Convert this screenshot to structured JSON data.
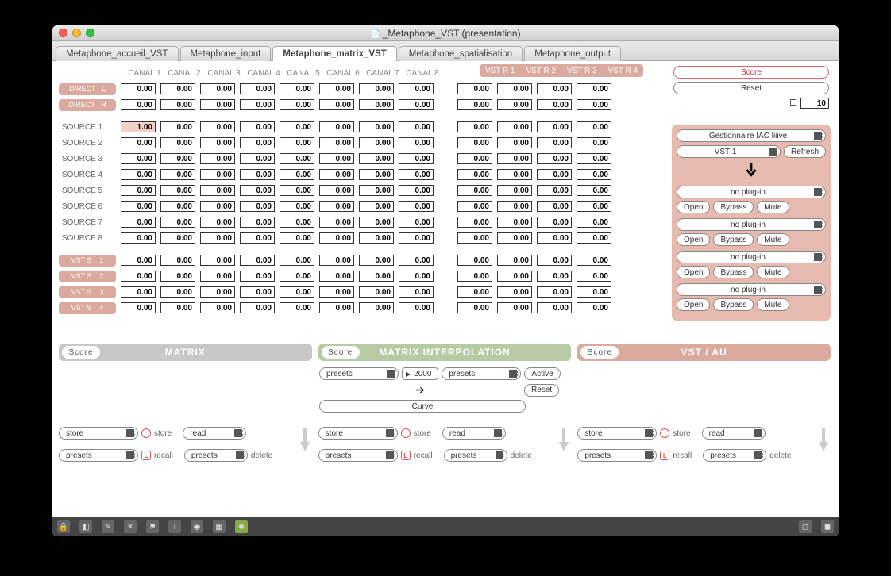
{
  "window": {
    "title": "_Metaphone_VST (presentation)"
  },
  "tabs": [
    {
      "label": "Metaphone_accueil_VST",
      "active": false
    },
    {
      "label": "Metaphone_input",
      "active": false
    },
    {
      "label": "Metaphone_matrix_VST",
      "active": true
    },
    {
      "label": "Metaphone_spatialisation",
      "active": false
    },
    {
      "label": "Metaphone_output",
      "active": false
    }
  ],
  "channels": [
    "CANAL 1",
    "CANAL 2",
    "CANAL 3",
    "CANAL 4",
    "CANAL 5",
    "CANAL 6",
    "CANAL 7",
    "CANAL 8"
  ],
  "vstr": [
    "VST R 1",
    "VST R 2",
    "VST R 3",
    "VST R 4"
  ],
  "direct": {
    "L": "DIRECT   L",
    "R": "DIRECT   R"
  },
  "rows_direct": [
    {
      "label": "DIRECT   L",
      "cells": [
        "0.00",
        "0.00",
        "0.00",
        "0.00",
        "0.00",
        "0.00",
        "0.00",
        "0.00"
      ],
      "vcells": [
        "0.00",
        "0.00",
        "0.00",
        "0.00"
      ]
    },
    {
      "label": "DIRECT   R",
      "cells": [
        "0.00",
        "0.00",
        "0.00",
        "0.00",
        "0.00",
        "0.00",
        "0.00",
        "0.00"
      ],
      "vcells": [
        "0.00",
        "0.00",
        "0.00",
        "0.00"
      ]
    }
  ],
  "rows_sources": [
    {
      "label": "SOURCE 1",
      "cells": [
        "1.00",
        "0.00",
        "0.00",
        "0.00",
        "0.00",
        "0.00",
        "0.00",
        "0.00"
      ],
      "vcells": [
        "0.00",
        "0.00",
        "0.00",
        "0.00"
      ],
      "hl": 0
    },
    {
      "label": "SOURCE 2",
      "cells": [
        "0.00",
        "0.00",
        "0.00",
        "0.00",
        "0.00",
        "0.00",
        "0.00",
        "0.00"
      ],
      "vcells": [
        "0.00",
        "0.00",
        "0.00",
        "0.00"
      ]
    },
    {
      "label": "SOURCE 3",
      "cells": [
        "0.00",
        "0.00",
        "0.00",
        "0.00",
        "0.00",
        "0.00",
        "0.00",
        "0.00"
      ],
      "vcells": [
        "0.00",
        "0.00",
        "0.00",
        "0.00"
      ]
    },
    {
      "label": "SOURCE 4",
      "cells": [
        "0.00",
        "0.00",
        "0.00",
        "0.00",
        "0.00",
        "0.00",
        "0.00",
        "0.00"
      ],
      "vcells": [
        "0.00",
        "0.00",
        "0.00",
        "0.00"
      ]
    },
    {
      "label": "SOURCE 5",
      "cells": [
        "0.00",
        "0.00",
        "0.00",
        "0.00",
        "0.00",
        "0.00",
        "0.00",
        "0.00"
      ],
      "vcells": [
        "0.00",
        "0.00",
        "0.00",
        "0.00"
      ]
    },
    {
      "label": "SOURCE 6",
      "cells": [
        "0.00",
        "0.00",
        "0.00",
        "0.00",
        "0.00",
        "0.00",
        "0.00",
        "0.00"
      ],
      "vcells": [
        "0.00",
        "0.00",
        "0.00",
        "0.00"
      ]
    },
    {
      "label": "SOURCE 7",
      "cells": [
        "0.00",
        "0.00",
        "0.00",
        "0.00",
        "0.00",
        "0.00",
        "0.00",
        "0.00"
      ],
      "vcells": [
        "0.00",
        "0.00",
        "0.00",
        "0.00"
      ]
    },
    {
      "label": "SOURCE 8",
      "cells": [
        "0.00",
        "0.00",
        "0.00",
        "0.00",
        "0.00",
        "0.00",
        "0.00",
        "0.00"
      ],
      "vcells": [
        "0.00",
        "0.00",
        "0.00",
        "0.00"
      ]
    }
  ],
  "rows_vsts": [
    {
      "label": "VST S    1",
      "cells": [
        "0.00",
        "0.00",
        "0.00",
        "0.00",
        "0.00",
        "0.00",
        "0.00",
        "0.00"
      ],
      "vcells": [
        "0.00",
        "0.00",
        "0.00",
        "0.00"
      ]
    },
    {
      "label": "VST S    2",
      "cells": [
        "0.00",
        "0.00",
        "0.00",
        "0.00",
        "0.00",
        "0.00",
        "0.00",
        "0.00"
      ],
      "vcells": [
        "0.00",
        "0.00",
        "0.00",
        "0.00"
      ]
    },
    {
      "label": "VST S    3",
      "cells": [
        "0.00",
        "0.00",
        "0.00",
        "0.00",
        "0.00",
        "0.00",
        "0.00",
        "0.00"
      ],
      "vcells": [
        "0.00",
        "0.00",
        "0.00",
        "0.00"
      ]
    },
    {
      "label": "VST S    4",
      "cells": [
        "0.00",
        "0.00",
        "0.00",
        "0.00",
        "0.00",
        "0.00",
        "0.00",
        "0.00"
      ],
      "vcells": [
        "0.00",
        "0.00",
        "0.00",
        "0.00"
      ]
    }
  ],
  "right": {
    "score": "Score",
    "reset": "Reset",
    "step": "10",
    "iac": "Gestionnaire IAC liiive",
    "vst1": "VST 1",
    "refresh": "Refresh",
    "noplugin": "no plug-in",
    "open": "Open",
    "bypass": "Bypass",
    "mute": "Mute"
  },
  "sections": {
    "matrix": "MATRIX",
    "interp": "MATRIX INTERPOLATION",
    "vstau": "VST / AU",
    "score": "Score"
  },
  "interp": {
    "presets": "presets",
    "time": "2000",
    "active": "Active",
    "reset": "Reset",
    "curve": "Curve"
  },
  "storeRecall": {
    "store": "store",
    "read": "read",
    "presets": "presets",
    "recall": "recall",
    "delete": "delete"
  }
}
